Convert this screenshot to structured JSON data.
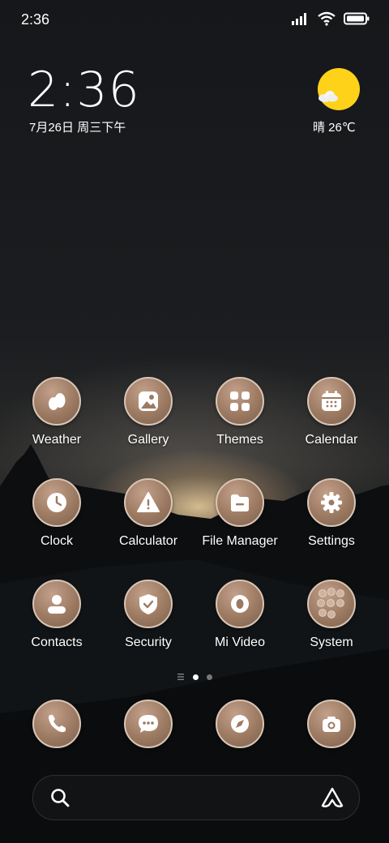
{
  "status_bar": {
    "time": "2:36"
  },
  "clock_widget": {
    "time": "2:36",
    "date": "7月26日 周三下午"
  },
  "weather_widget": {
    "text": "晴 26℃"
  },
  "apps": [
    {
      "label": "Weather",
      "icon": "weather-icon"
    },
    {
      "label": "Gallery",
      "icon": "gallery-icon"
    },
    {
      "label": "Themes",
      "icon": "themes-icon"
    },
    {
      "label": "Calendar",
      "icon": "calendar-icon"
    },
    {
      "label": "Clock",
      "icon": "clock-icon"
    },
    {
      "label": "Calculator",
      "icon": "calculator-icon"
    },
    {
      "label": "File Manager",
      "icon": "file-manager-icon"
    },
    {
      "label": "Settings",
      "icon": "settings-icon"
    },
    {
      "label": "Contacts",
      "icon": "contacts-icon"
    },
    {
      "label": "Security",
      "icon": "security-icon"
    },
    {
      "label": "Mi Video",
      "icon": "mi-video-icon"
    },
    {
      "label": "System",
      "icon": "system-folder-icon"
    }
  ],
  "dock": [
    {
      "icon": "phone-icon"
    },
    {
      "icon": "messages-icon"
    },
    {
      "icon": "browser-compass-icon"
    },
    {
      "icon": "camera-icon"
    }
  ],
  "page_indicator": {
    "pages": 2,
    "current": 1
  },
  "colors": {
    "icon_fill": "#9c7a62",
    "icon_border": "#d9c5b6",
    "sun": "#ffd21a"
  }
}
